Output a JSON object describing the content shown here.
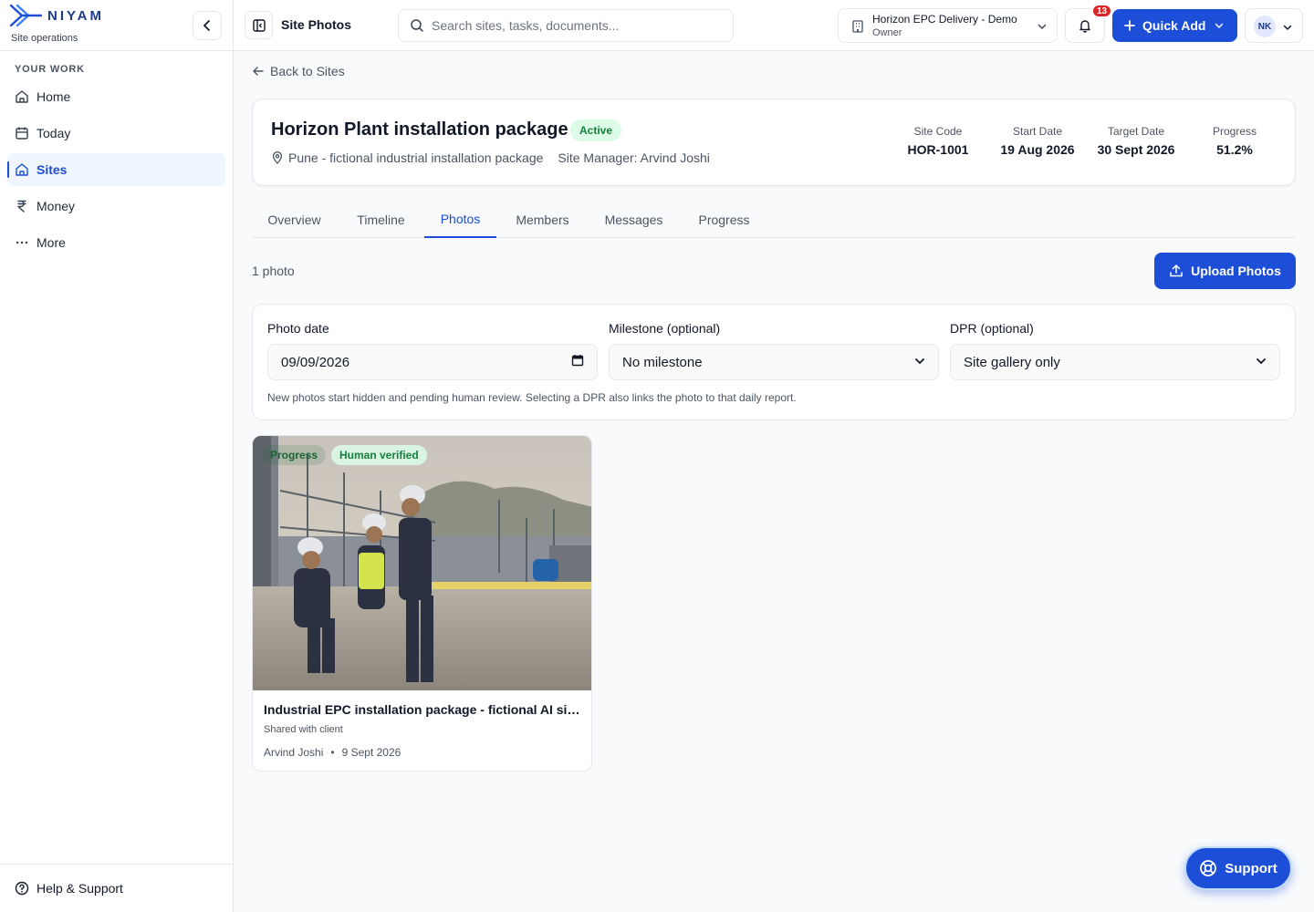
{
  "brand": {
    "name": "NIYAM",
    "subtitle": "Site operations"
  },
  "sidebar": {
    "section_label": "YOUR WORK",
    "items": [
      {
        "label": "Home",
        "icon": "home-icon"
      },
      {
        "label": "Today",
        "icon": "calendar-icon"
      },
      {
        "label": "Sites",
        "icon": "home-icon",
        "active": true
      },
      {
        "label": "Money",
        "icon": "rupee-icon"
      },
      {
        "label": "More",
        "icon": "ellipsis-icon"
      }
    ],
    "help_label": "Help & Support"
  },
  "topbar": {
    "title": "Site Photos",
    "search_placeholder": "Search sites, tasks, documents...",
    "org_name": "Horizon EPC Delivery - Demo",
    "org_role": "Owner",
    "notification_count": "13",
    "quick_add_label": "Quick Add",
    "user_initials": "NK"
  },
  "main": {
    "back_label": "Back to Sites",
    "site": {
      "name": "Horizon Plant installation package",
      "status": "Active",
      "location": "Pune - fictional industrial installation package",
      "manager": "Site Manager: Arvind Joshi",
      "stats": [
        {
          "label": "Site Code",
          "value": "HOR-1001"
        },
        {
          "label": "Start Date",
          "value": "19 Aug 2026"
        },
        {
          "label": "Target Date",
          "value": "30 Sept 2026"
        },
        {
          "label": "Progress",
          "value": "51.2%"
        }
      ]
    },
    "tabs": [
      "Overview",
      "Timeline",
      "Photos",
      "Members",
      "Messages",
      "Progress"
    ],
    "active_tab": "Photos",
    "photo_count": "1 photo",
    "upload_label": "Upload Photos",
    "filters": {
      "date_label": "Photo date",
      "date_value": "09/09/2026",
      "milestone_label": "Milestone (optional)",
      "milestone_value": "No milestone",
      "dpr_label": "DPR (optional)",
      "dpr_value": "Site gallery only",
      "hint": "New photos start hidden and pending human review. Selecting a DPR also links the photo to that daily report."
    },
    "photos": [
      {
        "tags": [
          "Progress",
          "Human verified"
        ],
        "title": "Industrial EPC installation package - fictional AI site photo",
        "shared": "Shared with client",
        "author": "Arvind Joshi",
        "separator": "•",
        "date": "9 Sept 2026"
      }
    ]
  },
  "support_label": "Support",
  "colors": {
    "primary": "#1d4ed8",
    "success": "#15803d",
    "badge": "#dc2626"
  }
}
